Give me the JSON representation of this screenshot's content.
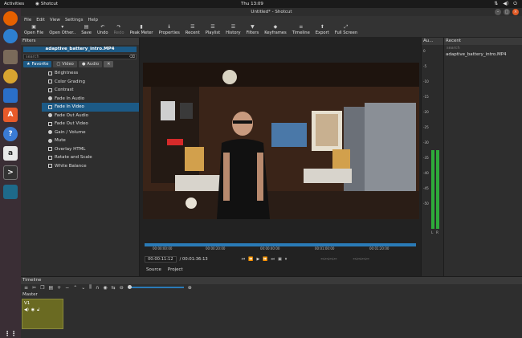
{
  "system": {
    "activities": "Activities",
    "app_name": "Shotcut",
    "clock": "Thu 13:09",
    "tray_icons": [
      "network-icon",
      "volume-icon",
      "power-icon"
    ]
  },
  "window": {
    "title": "Untitled* - Shotcut",
    "controls": [
      "–",
      "□",
      "×"
    ]
  },
  "menu": [
    "File",
    "Edit",
    "View",
    "Settings",
    "Help"
  ],
  "toolbar": [
    {
      "label": "Open File",
      "icon": "folder-icon",
      "glyph": "▣"
    },
    {
      "label": "Open Other..",
      "icon": "open-other-icon",
      "glyph": "▾"
    },
    {
      "label": "Save",
      "icon": "save-icon",
      "glyph": "▤"
    },
    {
      "label": "Undo",
      "icon": "undo-icon",
      "glyph": "↶"
    },
    {
      "label": "Redo",
      "icon": "redo-icon",
      "glyph": "↷",
      "disabled": true
    },
    {
      "label": "Peak Meter",
      "icon": "peak-meter-icon",
      "glyph": "▮"
    },
    {
      "label": "Properties",
      "icon": "properties-icon",
      "glyph": "ℹ"
    },
    {
      "label": "Recent",
      "icon": "recent-icon",
      "glyph": "☰"
    },
    {
      "label": "Playlist",
      "icon": "playlist-icon",
      "glyph": "☰"
    },
    {
      "label": "History",
      "icon": "history-icon",
      "glyph": "☰"
    },
    {
      "label": "Filters",
      "icon": "filters-icon",
      "glyph": "▼"
    },
    {
      "label": "Keyframes",
      "icon": "keyframes-icon",
      "glyph": "◆"
    },
    {
      "label": "Timeline",
      "icon": "timeline-icon",
      "glyph": "≡"
    },
    {
      "label": "Export",
      "icon": "export-icon",
      "glyph": "⬆"
    },
    {
      "label": "Full Screen",
      "icon": "fullscreen-icon",
      "glyph": "⤢"
    }
  ],
  "filters": {
    "header": "Filters",
    "clip": "adaptive_battery_intro.MP4",
    "search_placeholder": "search",
    "tabs": [
      "Favorite",
      "Video",
      "Audio"
    ],
    "items": [
      {
        "label": "Brightness",
        "kind": "video"
      },
      {
        "label": "Color Grading",
        "kind": "video"
      },
      {
        "label": "Contrast",
        "kind": "video"
      },
      {
        "label": "Fade In Audio",
        "kind": "audio"
      },
      {
        "label": "Fade In Video",
        "kind": "video",
        "selected": true
      },
      {
        "label": "Fade Out Audio",
        "kind": "audio"
      },
      {
        "label": "Fade Out Video",
        "kind": "video"
      },
      {
        "label": "Gain / Volume",
        "kind": "audio"
      },
      {
        "label": "Mute",
        "kind": "audio"
      },
      {
        "label": "Overlay HTML",
        "kind": "video"
      },
      {
        "label": "Rotate and Scale",
        "kind": "video"
      },
      {
        "label": "White Balance",
        "kind": "video"
      }
    ]
  },
  "player": {
    "ruler_ticks": [
      "00:00:00:00",
      "00:00:20:00",
      "00:00:40:00",
      "00:01:00:00",
      "00:01:20:00"
    ],
    "current_time": "00:00:11:12",
    "total_time": "/ 00:01:36:13",
    "in_point": "--:--:--:--",
    "out_point": "--:--:--:--",
    "tabs": [
      "Source",
      "Project"
    ]
  },
  "audio": {
    "header": "Au...",
    "scale": [
      "0",
      "-5",
      "-10",
      "-15",
      "-20",
      "-25",
      "-30",
      "-35",
      "-40",
      "-45",
      "-50"
    ],
    "channels": [
      "L",
      "R"
    ]
  },
  "recent": {
    "header": "Recent",
    "search_placeholder": "search",
    "items": [
      "adaptive_battery_intro.MP4"
    ]
  },
  "timeline": {
    "header": "Timeline",
    "master": "Master",
    "track": "V1"
  },
  "colors": {
    "accent": "#1c5a86",
    "track": "#6a6a22",
    "meter": "#2eaa3a"
  }
}
